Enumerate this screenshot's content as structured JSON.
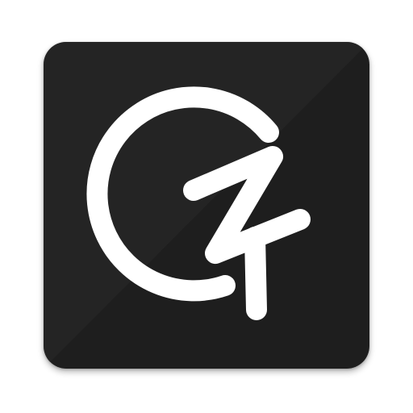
{
  "icon": {
    "name": "gz-logo-icon",
    "background_color": "#1e1e1e",
    "highlight_color": "#2a2a2a",
    "glyph_color": "#ffffff"
  }
}
